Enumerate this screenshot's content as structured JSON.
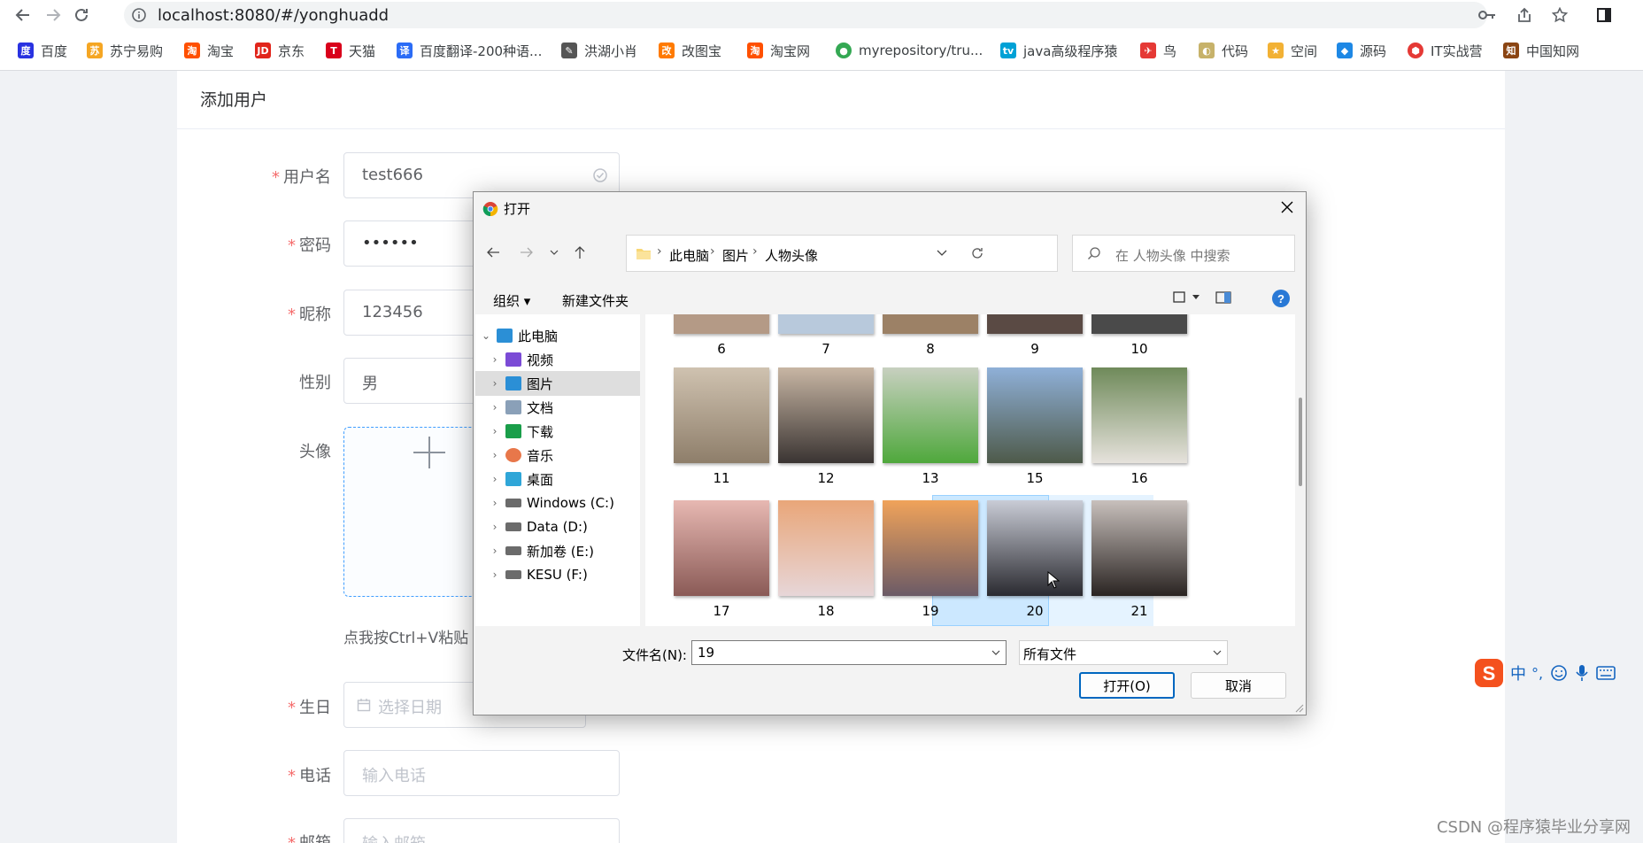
{
  "browser": {
    "url": "localhost:8080/#/yonghuadd",
    "bookmarks": [
      {
        "label": "百度",
        "color": "#2932e1"
      },
      {
        "label": "苏宁易购",
        "color": "#f5a623"
      },
      {
        "label": "淘宝",
        "color": "#ff5000"
      },
      {
        "label": "京东",
        "color": "#e1251b"
      },
      {
        "label": "天猫",
        "color": "#d9001b"
      },
      {
        "label": "百度翻译-200种语...",
        "color": "#2b6cf6"
      },
      {
        "label": "洪湖小肖",
        "color": "#555555"
      },
      {
        "label": "改图宝",
        "color": "#ff7a00"
      },
      {
        "label": "淘宝网",
        "color": "#ff5000"
      },
      {
        "label": "myrepository/tru...",
        "color": "#34a853"
      },
      {
        "label": "java高级程序猿",
        "color": "#00a1d6"
      },
      {
        "label": "鸟",
        "color": "#e53935"
      },
      {
        "label": "代码",
        "color": "#c7b26a"
      },
      {
        "label": "空间",
        "color": "#f2b134"
      },
      {
        "label": "源码",
        "color": "#1e88e5"
      },
      {
        "label": "IT实战营",
        "color": "#e53935"
      },
      {
        "label": "中国知网",
        "color": "#8b4513"
      }
    ]
  },
  "page": {
    "title": "添加用户",
    "form": {
      "username": {
        "label": "用户名",
        "value": "test666"
      },
      "password": {
        "label": "密码",
        "value": "••••••"
      },
      "nickname": {
        "label": "昵称",
        "value": "123456"
      },
      "gender": {
        "label": "性别",
        "value": "男"
      },
      "avatar": {
        "label": "头像",
        "hint": "点我按Ctrl+V粘贴"
      },
      "birthday": {
        "label": "生日",
        "placeholder": "选择日期"
      },
      "phone": {
        "label": "电话",
        "placeholder": "输入电话"
      },
      "email": {
        "label": "邮箱",
        "placeholder": "输入邮箱"
      }
    }
  },
  "dialog": {
    "title": "打开",
    "breadcrumb": [
      "此电脑",
      "图片",
      "人物头像"
    ],
    "search_placeholder": "在 人物头像 中搜索",
    "toolbar": {
      "organize": "组织 ▾",
      "new_folder": "新建文件夹"
    },
    "tree": [
      {
        "label": "此电脑",
        "expanded": true,
        "color": "#2b8fd6"
      },
      {
        "label": "视频",
        "color": "#7b4bd6"
      },
      {
        "label": "图片",
        "color": "#2b8fd6",
        "selected": true
      },
      {
        "label": "文档",
        "color": "#8aa0b8"
      },
      {
        "label": "下载",
        "color": "#1a9e4a"
      },
      {
        "label": "音乐",
        "color": "#e8774a"
      },
      {
        "label": "桌面",
        "color": "#2fa6d8"
      },
      {
        "label": "Windows (C:)",
        "color": "#6b6b6b"
      },
      {
        "label": "Data (D:)",
        "color": "#6b6b6b"
      },
      {
        "label": "新加卷 (E:)",
        "color": "#6b6b6b"
      },
      {
        "label": "KESU (F:)",
        "color": "#6b6b6b"
      }
    ],
    "files_row1": [
      {
        "name": "6",
        "color": "#b49a86"
      },
      {
        "name": "7",
        "color": "#b8c9dc"
      },
      {
        "name": "8",
        "color": "#9c8166"
      },
      {
        "name": "9",
        "color": "#5a4a44"
      },
      {
        "name": "10",
        "color": "#4a4a4a"
      }
    ],
    "files_row2": [
      {
        "name": "11",
        "color": "#b9a994"
      },
      {
        "name": "12",
        "color": "#8a7766"
      },
      {
        "name": "13",
        "color": "#5fae4a"
      },
      {
        "name": "15",
        "color": "#6f8aa6"
      },
      {
        "name": "16",
        "color": "#9aa68a"
      }
    ],
    "files_row3": [
      {
        "name": "17",
        "color": "#d4a09a"
      },
      {
        "name": "18",
        "color": "#e2b6a2"
      },
      {
        "name": "19",
        "color": "#d08a5c"
      },
      {
        "name": "20",
        "color": "#6a6a76"
      },
      {
        "name": "21",
        "color": "#6a5c56"
      }
    ],
    "filename_label": "文件名(N):",
    "filename_value": "19",
    "filetype_value": "所有文件",
    "open_label": "打开(O)",
    "cancel_label": "取消"
  },
  "ime": {
    "mode": "中",
    "punct": "°,"
  },
  "watermark": "CSDN @程序猿毕业分享网"
}
